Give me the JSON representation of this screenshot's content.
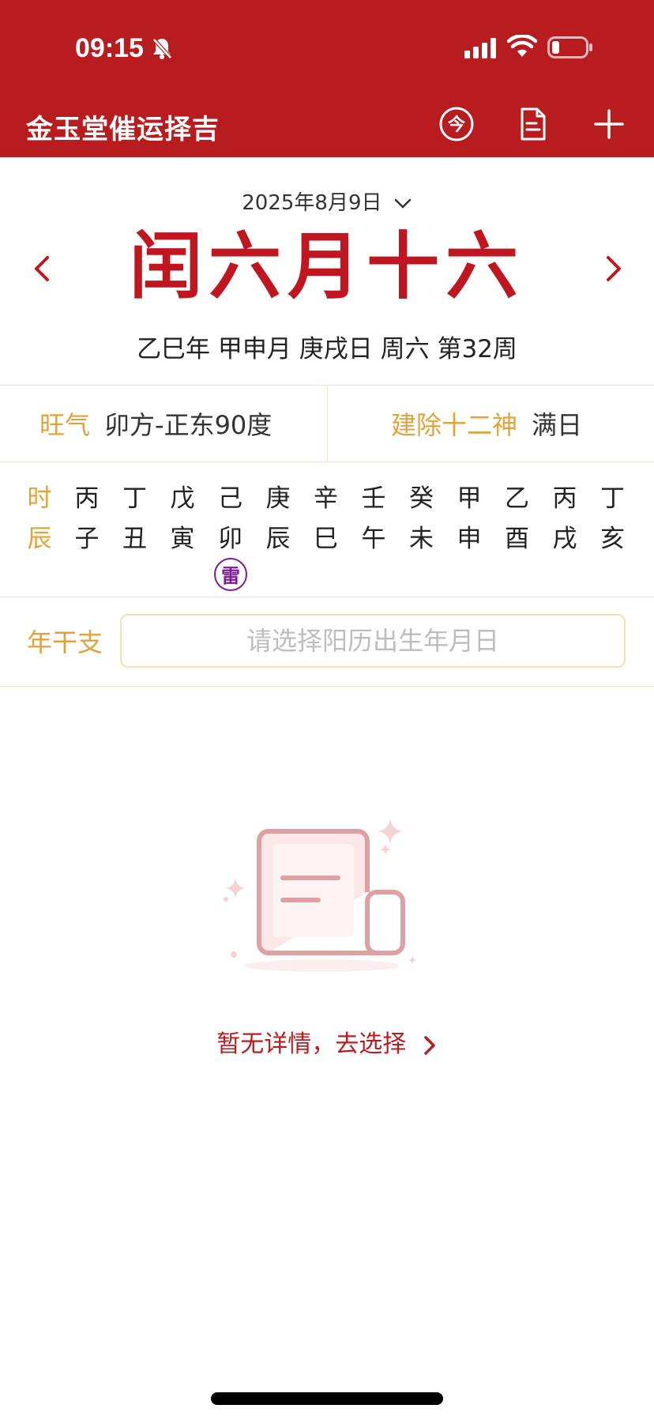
{
  "status_bar": {
    "time": "09:15",
    "icons": [
      "bell-muted-icon",
      "cellular-signal-icon",
      "wifi-icon",
      "battery-low-icon"
    ]
  },
  "header": {
    "title": "金玉堂催运择吉",
    "today_icon_glyph": "今",
    "icons": [
      "today-icon",
      "document-icon",
      "plus-icon"
    ],
    "bg_color": "#b81c1f"
  },
  "date": {
    "solar": "2025年8月9日",
    "lunar": "闰六月十六",
    "ganzhi": "乙巳年 甲申月 庚戌日 周六 第32周"
  },
  "info": {
    "wangqi_label": "旺气",
    "wangqi_value": "卯方-正东90度",
    "jianchu_label": "建除十二神",
    "jianchu_value": "满日"
  },
  "hours": {
    "stem_label": "时",
    "branch_label": "辰",
    "stems": [
      "丙",
      "丁",
      "戊",
      "己",
      "庚",
      "辛",
      "壬",
      "癸",
      "甲",
      "乙",
      "丙",
      "丁"
    ],
    "branches": [
      "子",
      "丑",
      "寅",
      "卯",
      "辰",
      "巳",
      "午",
      "未",
      "申",
      "酉",
      "戌",
      "亥"
    ],
    "badge": "雷",
    "badge_index": 3
  },
  "birth": {
    "label": "年干支",
    "placeholder": "请选择阳历出生年月日"
  },
  "empty_state": {
    "text": "暂无详情，去选择"
  },
  "colors": {
    "accent_red": "#c0161f",
    "label_gold": "#e2a23a",
    "badge_purple": "#7b1d94"
  }
}
